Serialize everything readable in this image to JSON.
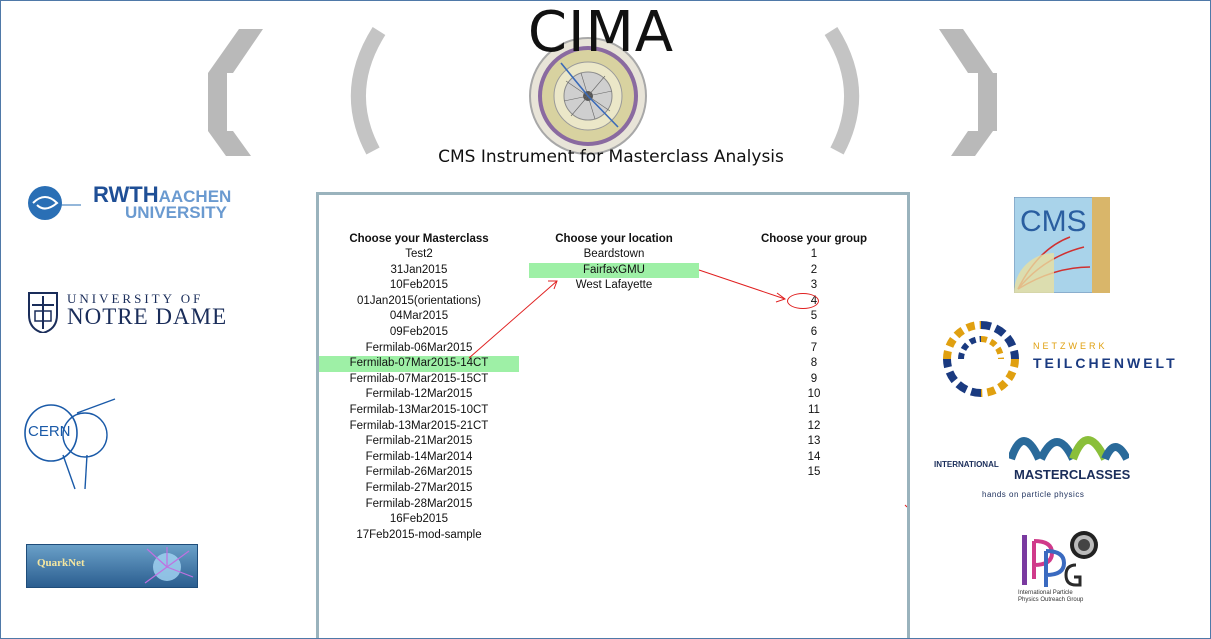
{
  "header": {
    "title": "CIMA",
    "subtitle": "CMS Instrument for Masterclass Analysis"
  },
  "panel": {
    "masterclass": {
      "heading": "Choose your Masterclass",
      "items": [
        "Test2",
        "31Jan2015",
        "10Feb2015",
        "01Jan2015(orientations)",
        "04Mar2015",
        "09Feb2015",
        "Fermilab-06Mar2015",
        "Fermilab-07Mar2015-14CT",
        "Fermilab-07Mar2015-15CT",
        "Fermilab-12Mar2015",
        "Fermilab-13Mar2015-10CT",
        "Fermilab-13Mar2015-21CT",
        "Fermilab-21Mar2015",
        "Fermilab-14Mar2014",
        "Fermilab-26Mar2015",
        "Fermilab-27Mar2015",
        "Fermilab-28Mar2015",
        "16Feb2015",
        "17Feb2015-mod-sample"
      ],
      "selected": "Fermilab-07Mar2015-14CT"
    },
    "location": {
      "heading": "Choose your location",
      "items": [
        "Beardstown",
        "FairfaxGMU",
        "West Lafayette"
      ],
      "selected": "FairfaxGMU"
    },
    "group": {
      "heading": "Choose your group",
      "items": [
        "1",
        "2",
        "3",
        "4",
        "5",
        "6",
        "7",
        "8",
        "9",
        "10",
        "11",
        "12",
        "13",
        "14",
        "15"
      ],
      "circled": "4"
    },
    "highlight_color": "#9ef0a6",
    "annotation_color": "#e02020"
  },
  "logos": {
    "rwth": {
      "line1": "RWTH",
      "line2": "AACHEN",
      "line3": "UNIVERSITY"
    },
    "notre_dame": {
      "line1": "UNIVERSITY OF",
      "line2": "NOTRE DAME"
    },
    "cern": {
      "text": "CERN"
    },
    "quarknet": {
      "text": "QuarkNet"
    },
    "cms": {
      "text": "CMS"
    },
    "netzwerk": {
      "line1": "NETZWERK",
      "line2": "TEILCHENWELT"
    },
    "masterclasses": {
      "line1": "INTERNATIONAL",
      "line2": "MASTERCLASSES",
      "line3": "hands on particle physics"
    },
    "ippog": {
      "line1": "International Particle",
      "line2": "Physics Outreach Group"
    }
  }
}
